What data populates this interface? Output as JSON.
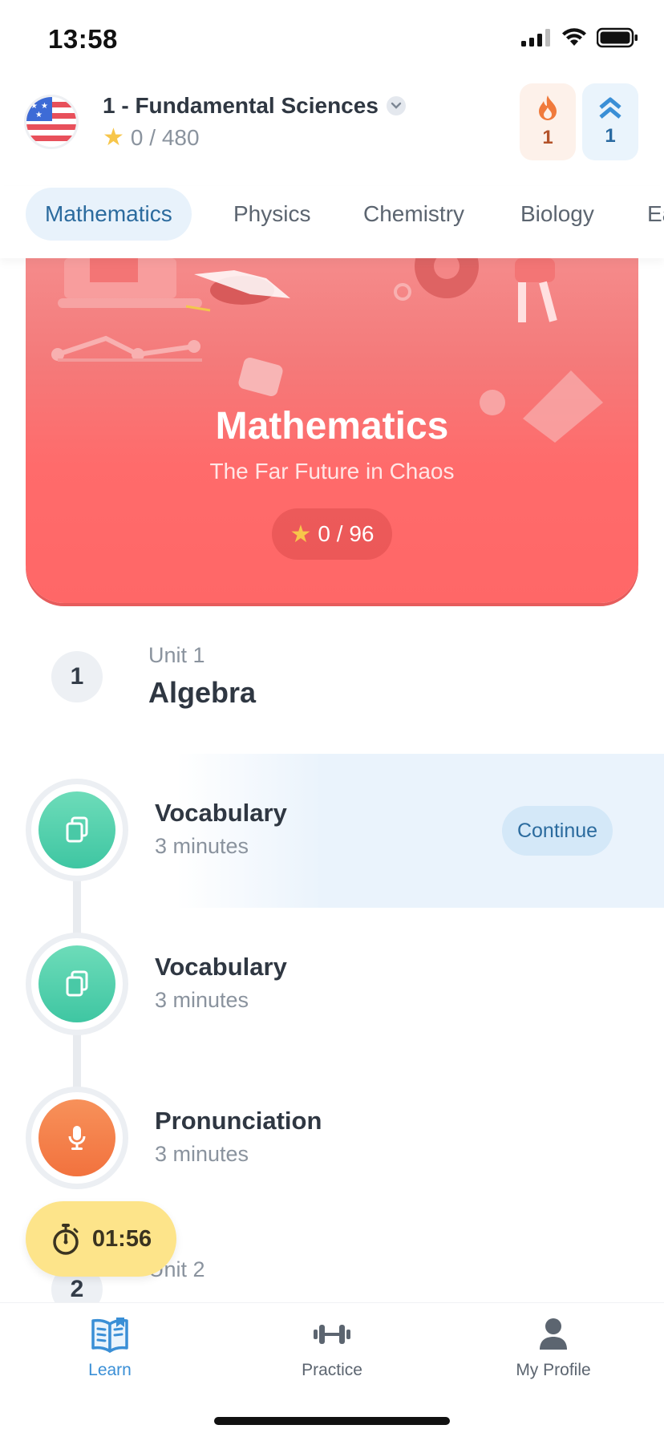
{
  "status_bar": {
    "time": "13:58"
  },
  "header": {
    "course_title": "1 - Fundamental Sciences",
    "course_stars": "0 / 480",
    "streak_count": "1",
    "level_count": "1"
  },
  "tabs": [
    {
      "label": "Mathematics",
      "active": true
    },
    {
      "label": "Physics"
    },
    {
      "label": "Chemistry"
    },
    {
      "label": "Biology"
    },
    {
      "label": "Ea"
    }
  ],
  "hero": {
    "title": "Mathematics",
    "subtitle": "The Far Future in Chaos",
    "stars": "0 / 96",
    "color": "#ff6b6b"
  },
  "units": [
    {
      "number": "1",
      "label": "Unit 1",
      "title": "Algebra",
      "lessons": [
        {
          "title": "Vocabulary",
          "duration": "3 minutes",
          "icon": "cards-icon",
          "color": "#3fc6a2",
          "action": "Continue"
        },
        {
          "title": "Vocabulary",
          "duration": "3 minutes",
          "icon": "cards-icon",
          "color": "#3fc6a2"
        },
        {
          "title": "Pronunciation",
          "duration": "3 minutes",
          "icon": "microphone-icon",
          "color": "#f2723e"
        }
      ]
    },
    {
      "number": "2",
      "label": "Unit 2",
      "title": ""
    }
  ],
  "timer": {
    "value": "01:56"
  },
  "bottom_nav": [
    {
      "label": "Learn",
      "icon": "book-icon",
      "active": true
    },
    {
      "label": "Practice",
      "icon": "dumbbell-icon"
    },
    {
      "label": "My Profile",
      "icon": "person-icon"
    }
  ],
  "accent_color": "#3a8fd6"
}
